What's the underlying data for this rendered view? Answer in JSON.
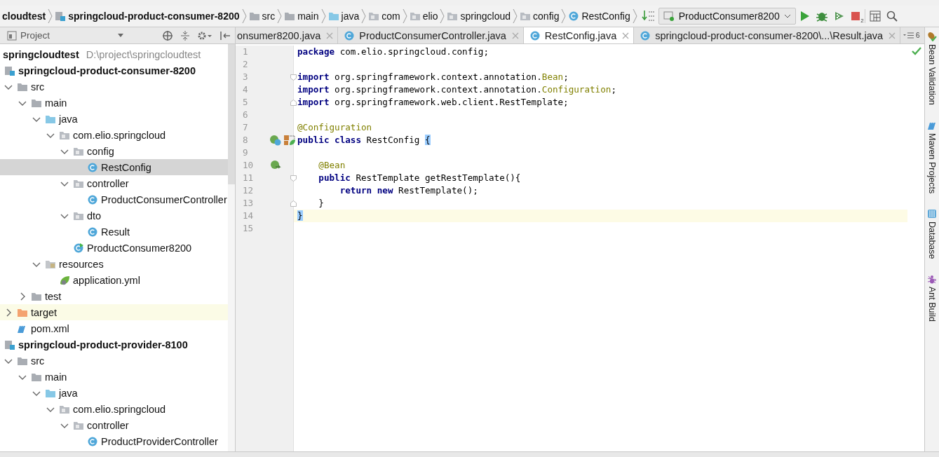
{
  "breadcrumbs": [
    {
      "label": "cloudtest",
      "kind": "project"
    },
    {
      "label": "springcloud-product-consumer-8200",
      "kind": "module"
    },
    {
      "label": "src",
      "kind": "folder"
    },
    {
      "label": "main",
      "kind": "folder"
    },
    {
      "label": "java",
      "kind": "source-folder"
    },
    {
      "label": "com",
      "kind": "package"
    },
    {
      "label": "elio",
      "kind": "package"
    },
    {
      "label": "springcloud",
      "kind": "package"
    },
    {
      "label": "config",
      "kind": "package"
    },
    {
      "label": "RestConfig",
      "kind": "class"
    }
  ],
  "run_config": {
    "label": "ProductConsumer8200"
  },
  "stop_badge": "2",
  "project_panel": {
    "title": "Project",
    "root": {
      "label": "springcloudtest",
      "path": "D:\\project\\springcloudtest"
    },
    "tree": [
      {
        "label": "springcloud-product-consumer-8200",
        "kind": "module",
        "selected": false,
        "highlighted": false,
        "children": [
          {
            "label": "src",
            "kind": "folder",
            "expanded": true,
            "selected": false,
            "highlighted": false,
            "children": [
              {
                "label": "main",
                "kind": "folder",
                "expanded": true,
                "selected": false,
                "highlighted": false,
                "children": [
                  {
                    "label": "java",
                    "kind": "source-folder",
                    "expanded": true,
                    "selected": false,
                    "highlighted": false,
                    "children": [
                      {
                        "label": "com.elio.springcloud",
                        "kind": "package",
                        "expanded": true,
                        "selected": false,
                        "highlighted": false,
                        "children": [
                          {
                            "label": "config",
                            "kind": "package",
                            "expanded": true,
                            "selected": false,
                            "highlighted": false,
                            "children": [
                              {
                                "label": "RestConfig",
                                "kind": "class",
                                "selected": true,
                                "highlighted": false
                              }
                            ]
                          },
                          {
                            "label": "controller",
                            "kind": "package",
                            "expanded": true,
                            "selected": false,
                            "highlighted": false,
                            "children": [
                              {
                                "label": "ProductConsumerController",
                                "kind": "class",
                                "selected": false,
                                "highlighted": false
                              }
                            ]
                          },
                          {
                            "label": "dto",
                            "kind": "package",
                            "expanded": true,
                            "selected": false,
                            "highlighted": false,
                            "children": [
                              {
                                "label": "Result",
                                "kind": "class",
                                "selected": false,
                                "highlighted": false
                              }
                            ]
                          },
                          {
                            "label": "ProductConsumer8200",
                            "kind": "boot-class",
                            "selected": false,
                            "highlighted": false
                          }
                        ]
                      }
                    ]
                  },
                  {
                    "label": "resources",
                    "kind": "resources",
                    "expanded": true,
                    "selected": false,
                    "highlighted": false,
                    "children": [
                      {
                        "label": "application.yml",
                        "kind": "spring-yml",
                        "selected": false,
                        "highlighted": false
                      }
                    ]
                  }
                ]
              },
              {
                "label": "test",
                "kind": "folder",
                "expanded": false,
                "selected": false,
                "highlighted": false
              }
            ]
          },
          {
            "label": "target",
            "kind": "target-folder",
            "expanded": false,
            "selected": false,
            "highlighted": true
          },
          {
            "label": "pom.xml",
            "kind": "maven",
            "selected": false,
            "highlighted": false
          }
        ]
      },
      {
        "label": "springcloud-product-provider-8100",
        "kind": "module",
        "selected": false,
        "highlighted": false,
        "children": [
          {
            "label": "src",
            "kind": "folder",
            "expanded": true,
            "selected": false,
            "highlighted": false,
            "children": [
              {
                "label": "main",
                "kind": "folder",
                "expanded": true,
                "selected": false,
                "highlighted": false,
                "children": [
                  {
                    "label": "java",
                    "kind": "source-folder",
                    "expanded": true,
                    "selected": false,
                    "highlighted": false,
                    "children": [
                      {
                        "label": "com.elio.springcloud",
                        "kind": "package",
                        "expanded": true,
                        "selected": false,
                        "highlighted": false,
                        "children": [
                          {
                            "label": "controller",
                            "kind": "package",
                            "expanded": true,
                            "selected": false,
                            "highlighted": false,
                            "children": [
                              {
                                "label": "ProductProviderController",
                                "kind": "class",
                                "selected": false,
                                "highlighted": false
                              }
                            ]
                          }
                        ]
                      }
                    ]
                  }
                ]
              }
            ]
          }
        ]
      }
    ]
  },
  "tabs": [
    {
      "label": "onsumer8200.java",
      "icon": false,
      "selected": false
    },
    {
      "label": "ProductConsumerController.java",
      "icon": true,
      "selected": false
    },
    {
      "label": "RestConfig.java",
      "icon": true,
      "selected": true
    },
    {
      "label": "springcloud-product-consumer-8200\\...\\Result.java",
      "icon": true,
      "selected": false
    }
  ],
  "tabs_overflow": "6",
  "editor": {
    "lines": [
      {
        "number": "1",
        "current": false,
        "fold_start": false,
        "fold_end": false,
        "tokens": [
          {
            "text": "package",
            "kind": "keyword"
          },
          {
            "text": " com.elio.springcloud.config;",
            "kind": "plain"
          }
        ]
      },
      {
        "number": "2",
        "current": false,
        "fold_start": false,
        "fold_end": false
      },
      {
        "number": "3",
        "current": false,
        "fold_start": true,
        "fold_end": false,
        "tokens": [
          {
            "text": "import",
            "kind": "keyword"
          },
          {
            "text": " org.springframework.context.annotation.",
            "kind": "plain"
          },
          {
            "text": "Bean",
            "kind": "reference"
          },
          {
            "text": ";",
            "kind": "plain"
          }
        ]
      },
      {
        "number": "4",
        "current": false,
        "fold_start": false,
        "fold_end": false,
        "tokens": [
          {
            "text": "import",
            "kind": "keyword"
          },
          {
            "text": " org.springframework.context.annotation.",
            "kind": "plain"
          },
          {
            "text": "Configuration",
            "kind": "reference"
          },
          {
            "text": ";",
            "kind": "plain"
          }
        ]
      },
      {
        "number": "5",
        "current": false,
        "fold_start": false,
        "fold_end": true,
        "tokens": [
          {
            "text": "import",
            "kind": "keyword"
          },
          {
            "text": " org.springframework.web.client.RestTemplate;",
            "kind": "plain"
          }
        ]
      },
      {
        "number": "6",
        "current": false,
        "fold_start": false,
        "fold_end": false
      },
      {
        "number": "7",
        "current": false,
        "fold_start": false,
        "fold_end": false,
        "tokens": [
          {
            "text": "@Configuration",
            "kind": "annotation"
          }
        ]
      },
      {
        "number": "8",
        "current": false,
        "fold_start": false,
        "fold_end": false,
        "gutter_icons": [
          {
            "kind": "bean-class"
          },
          {
            "kind": "spring-config"
          }
        ],
        "tokens": [
          {
            "text": "public class",
            "kind": "keyword"
          },
          {
            "text": " RestConfig ",
            "kind": "plain"
          },
          {
            "text": "{",
            "kind": "brace-match"
          }
        ]
      },
      {
        "number": "9",
        "current": false,
        "fold_start": false,
        "fold_end": false
      },
      {
        "number": "10",
        "current": false,
        "fold_start": false,
        "fold_end": false,
        "gutter_icons": [
          {
            "kind": "bean-method"
          }
        ],
        "tokens": [
          {
            "text": "    @Bean",
            "kind": "annotation"
          }
        ]
      },
      {
        "number": "11",
        "current": false,
        "fold_start": true,
        "fold_end": false,
        "tokens": [
          {
            "text": "    public",
            "kind": "keyword"
          },
          {
            "text": " RestTemplate getRestTemplate(){",
            "kind": "plain"
          }
        ]
      },
      {
        "number": "12",
        "current": false,
        "fold_start": false,
        "fold_end": false,
        "tokens": [
          {
            "text": "        return new",
            "kind": "keyword"
          },
          {
            "text": " RestTemplate();",
            "kind": "plain"
          }
        ]
      },
      {
        "number": "13",
        "current": false,
        "fold_start": false,
        "fold_end": true,
        "tokens": [
          {
            "text": "    }",
            "kind": "plain"
          }
        ]
      },
      {
        "number": "14",
        "current": true,
        "fold_start": false,
        "fold_end": false,
        "tokens": [
          {
            "text": "}",
            "kind": "brace-match"
          }
        ]
      },
      {
        "number": "15",
        "current": false,
        "fold_start": false,
        "fold_end": false
      }
    ]
  },
  "right_sidebar": [
    {
      "label": "Bean Validation",
      "kind": "bean"
    },
    {
      "label": "Maven Projects",
      "kind": "maven"
    },
    {
      "label": "Database",
      "kind": "database"
    },
    {
      "label": "Ant Build",
      "kind": "ant"
    }
  ]
}
